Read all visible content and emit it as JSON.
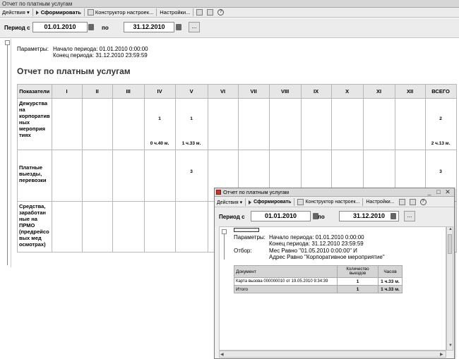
{
  "main": {
    "window_title": "Отчет  по платным услугам",
    "toolbar": {
      "actions": "Действия ▾",
      "generate": "Сформировать",
      "constructor": "Конструктор настроек...",
      "settings": "Настройки..."
    },
    "period": {
      "from_label": "Период с",
      "from_value": "01.01.2010",
      "to_label": "по",
      "to_value": "31.12.2010",
      "more_button": "..."
    },
    "params": {
      "label": "Параметры:",
      "start": "Начало периода: 01.01.2010 0:00:00",
      "end": "Конец  периода: 31.12.2010 23:59:59"
    },
    "report_title": "Отчет по платным услугам",
    "table": {
      "corner": "Показатели",
      "columns": [
        "I",
        "II",
        "III",
        "IV",
        "V",
        "VI",
        "VII",
        "VIII",
        "IX",
        "X",
        "XI",
        "XII",
        "ВСЕГО"
      ],
      "rows": [
        {
          "label": "Дежурства на корпоратив ных мероприя тиях",
          "cells": [
            {
              "top": "",
              "bottom": ""
            },
            {
              "top": "",
              "bottom": ""
            },
            {
              "top": "",
              "bottom": ""
            },
            {
              "top": "1",
              "bottom": "0 ч.40 м."
            },
            {
              "top": "1",
              "bottom": "1 ч.33 м."
            },
            {
              "top": "",
              "bottom": ""
            },
            {
              "top": "",
              "bottom": ""
            },
            {
              "top": "",
              "bottom": ""
            },
            {
              "top": "",
              "bottom": ""
            },
            {
              "top": "",
              "bottom": ""
            },
            {
              "top": "",
              "bottom": ""
            },
            {
              "top": "",
              "bottom": ""
            },
            {
              "top": "2",
              "bottom": "2 ч.13 м."
            }
          ]
        },
        {
          "label": "Платные выезды, перевозки",
          "cells": [
            {
              "top": "",
              "bottom": ""
            },
            {
              "top": "",
              "bottom": ""
            },
            {
              "top": "",
              "bottom": ""
            },
            {
              "top": "",
              "bottom": ""
            },
            {
              "top": "3",
              "bottom": ""
            },
            {
              "top": "",
              "bottom": ""
            },
            {
              "top": "",
              "bottom": ""
            },
            {
              "top": "",
              "bottom": ""
            },
            {
              "top": "",
              "bottom": ""
            },
            {
              "top": "",
              "bottom": ""
            },
            {
              "top": "",
              "bottom": ""
            },
            {
              "top": "",
              "bottom": ""
            },
            {
              "top": "3",
              "bottom": ""
            }
          ]
        },
        {
          "label": "Средства, заработан ные на ПРМО (предрейсо вых мед осмотрах)",
          "cells": [
            {
              "top": "",
              "bottom": ""
            },
            {
              "top": "",
              "bottom": ""
            },
            {
              "top": "",
              "bottom": ""
            },
            {
              "top": "",
              "bottom": ""
            },
            {
              "top": "",
              "bottom": ""
            },
            {
              "top": "",
              "bottom": ""
            },
            {
              "top": "",
              "bottom": ""
            },
            {
              "top": "",
              "bottom": ""
            },
            {
              "top": "",
              "bottom": ""
            },
            {
              "top": "",
              "bottom": ""
            },
            {
              "top": "",
              "bottom": ""
            },
            {
              "top": "",
              "bottom": ""
            },
            {
              "top": "",
              "bottom": ""
            }
          ]
        }
      ]
    }
  },
  "popup": {
    "window_title": "Отчет  по платным услугам",
    "controls": {
      "minimize": "_",
      "maximize": "□",
      "close": "✕"
    },
    "toolbar": {
      "actions": "Действия ▾",
      "generate": "Сформировать",
      "constructor": "Конструктор настроек...",
      "settings": "Настройки..."
    },
    "period": {
      "from_label": "Период с",
      "from_value": "01.01.2010",
      "to_label": "по",
      "to_value": "31.12.2010",
      "more_button": "..."
    },
    "params": {
      "label": "Параметры:",
      "start": "Начало периода: 01.01.2010 0:00:00",
      "end": "Конец   периода: 31.12.2010 23:59:59",
      "filter_label": "Отбор:",
      "filter_line1": "Мес Равно \"01.05.2010 0:00:00\" И",
      "filter_line2": "Адрес Равно \"Корпоративное мероприятие\""
    },
    "table": {
      "headers": [
        "Документ",
        "Количество выездов",
        "Часов"
      ],
      "rows": [
        {
          "doc": "Карта вызова 000000010 от 19.05.2010 9:34:39",
          "count": "1",
          "hours": "1 ч.33 м."
        }
      ],
      "total": {
        "label": "Итого",
        "count": "1",
        "hours": "1 ч.33 м."
      }
    }
  }
}
